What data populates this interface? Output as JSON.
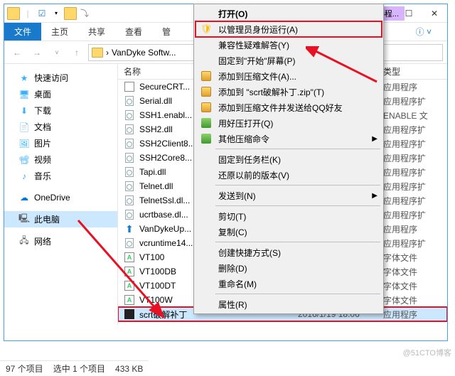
{
  "titlebar": {
    "contextual": "应用程..."
  },
  "ribbon": {
    "file": "文件",
    "home": "主页",
    "share": "共享",
    "view": "查看",
    "manage": "管"
  },
  "breadcrumb": {
    "path": "VanDyke Softw...",
    "sep": "›"
  },
  "columns": {
    "name": "名称",
    "date": "",
    "type": "类型"
  },
  "sidebar": [
    {
      "label": "快速访问",
      "icon": "star",
      "color": "#3bb0ff"
    },
    {
      "label": "桌面",
      "icon": "desktop",
      "color": "#3bb0ff"
    },
    {
      "label": "下载",
      "icon": "download",
      "color": "#3bb0ff"
    },
    {
      "label": "文档",
      "icon": "doc",
      "color": "#3bb0ff"
    },
    {
      "label": "图片",
      "icon": "pic",
      "color": "#3bb0ff"
    },
    {
      "label": "视频",
      "icon": "video",
      "color": "#3bb0ff"
    },
    {
      "label": "音乐",
      "icon": "music",
      "color": "#3bb0ff"
    },
    {
      "label": "",
      "icon": "",
      "color": ""
    },
    {
      "label": "OneDrive",
      "icon": "cloud",
      "color": "#0078d7"
    },
    {
      "label": "",
      "icon": "",
      "color": ""
    },
    {
      "label": "此电脑",
      "icon": "pc",
      "color": "#555",
      "sel": true
    },
    {
      "label": "",
      "icon": "",
      "color": ""
    },
    {
      "label": "网络",
      "icon": "net",
      "color": "#555"
    }
  ],
  "files": [
    {
      "name": "SecureCRT...",
      "type": "应用程序",
      "ico": "exe"
    },
    {
      "name": "Serial.dll",
      "type": "应用程序扩",
      "ico": "dll"
    },
    {
      "name": "SSH1.enabl...",
      "type": "ENABLE 文",
      "ico": "dll"
    },
    {
      "name": "SSH2.dll",
      "type": "应用程序扩",
      "ico": "dll"
    },
    {
      "name": "SSH2Client8...",
      "type": "应用程序扩",
      "ico": "dll"
    },
    {
      "name": "SSH2Core8...",
      "type": "应用程序扩",
      "ico": "dll"
    },
    {
      "name": "Tapi.dll",
      "type": "应用程序扩",
      "ico": "dll"
    },
    {
      "name": "Telnet.dll",
      "type": "应用程序扩",
      "ico": "dll"
    },
    {
      "name": "TelnetSsl.dl...",
      "type": "应用程序扩",
      "ico": "dll"
    },
    {
      "name": "ucrtbase.dl...",
      "type": "应用程序扩",
      "ico": "dll"
    },
    {
      "name": "VanDykeUp...",
      "type": "应用程序",
      "ico": "up"
    },
    {
      "name": "vcruntime14...",
      "type": "应用程序扩",
      "ico": "dll"
    },
    {
      "name": "VT100",
      "type": "字体文件",
      "ico": "font"
    },
    {
      "name": "VT100DB",
      "type": "字体文件",
      "ico": "font"
    },
    {
      "name": "VT100DT",
      "type": "字体文件",
      "ico": "font"
    },
    {
      "name": "VT100W",
      "type": "字体文件",
      "ico": "font"
    },
    {
      "name": "scrt破解补丁",
      "date": "2016/1/19 18:06",
      "type": "应用程序",
      "ico": "scrt",
      "sel": true
    }
  ],
  "status": {
    "count": "97 个项目",
    "sel": "选中 1 个项目",
    "size": "433 KB"
  },
  "menu": [
    {
      "label": "打开(O)",
      "bold": true
    },
    {
      "label": "以管理员身份运行(A)",
      "ico": "shield",
      "hl": true
    },
    {
      "label": "兼容性疑难解答(Y)"
    },
    {
      "label": "固定到\"开始\"屏幕(P)"
    },
    {
      "label": "添加到压缩文件(A)...",
      "ico": "zip"
    },
    {
      "label": "添加到 \"scrt破解补丁.zip\"(T)",
      "ico": "zip"
    },
    {
      "label": "添加到压缩文件并发送给QQ好友",
      "ico": "zip"
    },
    {
      "label": "用好压打开(Q)",
      "ico": "good"
    },
    {
      "label": "其他压缩命令",
      "ico": "good",
      "sub": true
    },
    {
      "sep": true
    },
    {
      "label": "固定到任务栏(K)"
    },
    {
      "label": "还原以前的版本(V)"
    },
    {
      "sep": true
    },
    {
      "label": "发送到(N)",
      "sub": true
    },
    {
      "sep": true
    },
    {
      "label": "剪切(T)"
    },
    {
      "label": "复制(C)"
    },
    {
      "sep": true
    },
    {
      "label": "创建快捷方式(S)"
    },
    {
      "label": "删除(D)"
    },
    {
      "label": "重命名(M)"
    },
    {
      "sep": true
    },
    {
      "label": "属性(R)"
    }
  ],
  "watermark": "@51CTO博客"
}
